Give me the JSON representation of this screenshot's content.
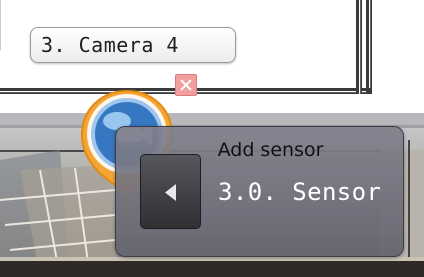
{
  "camera": {
    "label": "3. Camera 4"
  },
  "popup": {
    "title": "Add sensor",
    "sensor_label": "3.0. Sensor"
  },
  "icons": {
    "remove": "close-icon",
    "previous": "chevron-left-icon",
    "pin": "camera-pin-icon"
  },
  "colors": {
    "pin_ring": "#f4a12a",
    "pin_core": "#3d82c8",
    "remove_button": "#f19e9e",
    "popup_background": "#7d7d88",
    "popup_button": "#3a3a40",
    "sensor_text": "#ffffff"
  }
}
